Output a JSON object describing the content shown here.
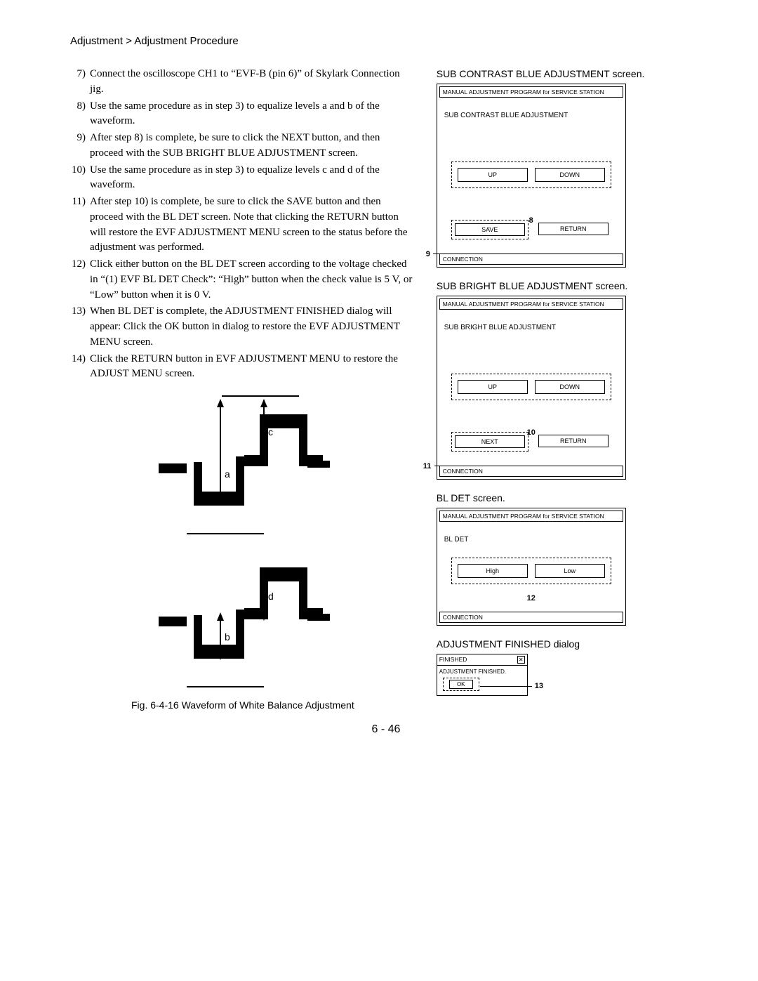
{
  "breadcrumb": "Adjustment > Adjustment Procedure",
  "steps": [
    {
      "n": "7)",
      "t": "Connect the oscilloscope CH1 to “EVF-B (pin 6)” of Skylark Connection jig."
    },
    {
      "n": "8)",
      "t": "Use the same procedure as in step 3) to equalize levels a and b of the waveform."
    },
    {
      "n": "9)",
      "t": "After step 8) is complete, be sure to click the NEXT button, and then proceed with the SUB BRIGHT BLUE ADJUSTMENT screen."
    },
    {
      "n": "10)",
      "t": "Use the same procedure as in step 3) to equalize levels c and d of the waveform."
    },
    {
      "n": "11)",
      "t": "After step 10) is complete, be sure to click the SAVE button and then proceed with the BL DET screen. Note that clicking the RETURN button will restore the EVF ADJUSTMENT MENU screen to the status before the adjustment was performed."
    },
    {
      "n": "12)",
      "t": "Click either button on the BL DET screen according to the voltage checked in “(1) EVF BL DET Check”: “High” button when the check value is 5 V, or “Low” button when it is 0 V."
    },
    {
      "n": "13)",
      "t": "When BL DET is complete, the ADJUSTMENT FINISHED dialog will appear: Click the OK button in dialog to restore the EVF ADJUSTMENT MENU screen."
    },
    {
      "n": "14)",
      "t": "Click the RETURN button in EVF ADJUSTMENT MENU to restore the ADJUST MENU screen."
    }
  ],
  "wave_labels": {
    "a": "a",
    "b": "b",
    "c": "c",
    "d": "d"
  },
  "fig_caption": "Fig. 6-4-16 Waveform of White Balance Adjustment",
  "screen1": {
    "caption": "SUB CONTRAST BLUE ADJUSTMENT screen.",
    "titlebar": "MANUAL ADJUSTMENT PROGRAM for SERVICE STATION",
    "title": "SUB CONTRAST BLUE ADJUSTMENT",
    "up": "UP",
    "down": "DOWN",
    "ud_call": "8",
    "left_call": "9",
    "save": "SAVE",
    "return": "RETURN",
    "conn": "CONNECTION"
  },
  "screen2": {
    "caption": "SUB BRIGHT BLUE ADJUSTMENT screen.",
    "titlebar": "MANUAL ADJUSTMENT PROGRAM for SERVICE STATION",
    "title": "SUB BRIGHT BLUE ADJUSTMENT",
    "up": "UP",
    "down": "DOWN",
    "ud_call": "10",
    "left_call": "11",
    "next": "NEXT",
    "return": "RETURN",
    "conn": "CONNECTION"
  },
  "screen3": {
    "caption": "BL DET screen.",
    "titlebar": "MANUAL ADJUSTMENT PROGRAM for SERVICE STATION",
    "title": "BL DET",
    "high": "High",
    "low": "Low",
    "ud_call": "12",
    "conn": "CONNECTION"
  },
  "dlg": {
    "caption": "ADJUSTMENT FINISHED dialog",
    "hdr": "FINISHED",
    "msg": "ADJUSTMENT FINISHED.",
    "ok": "OK",
    "call": "13"
  },
  "page_num": "6 - 46"
}
